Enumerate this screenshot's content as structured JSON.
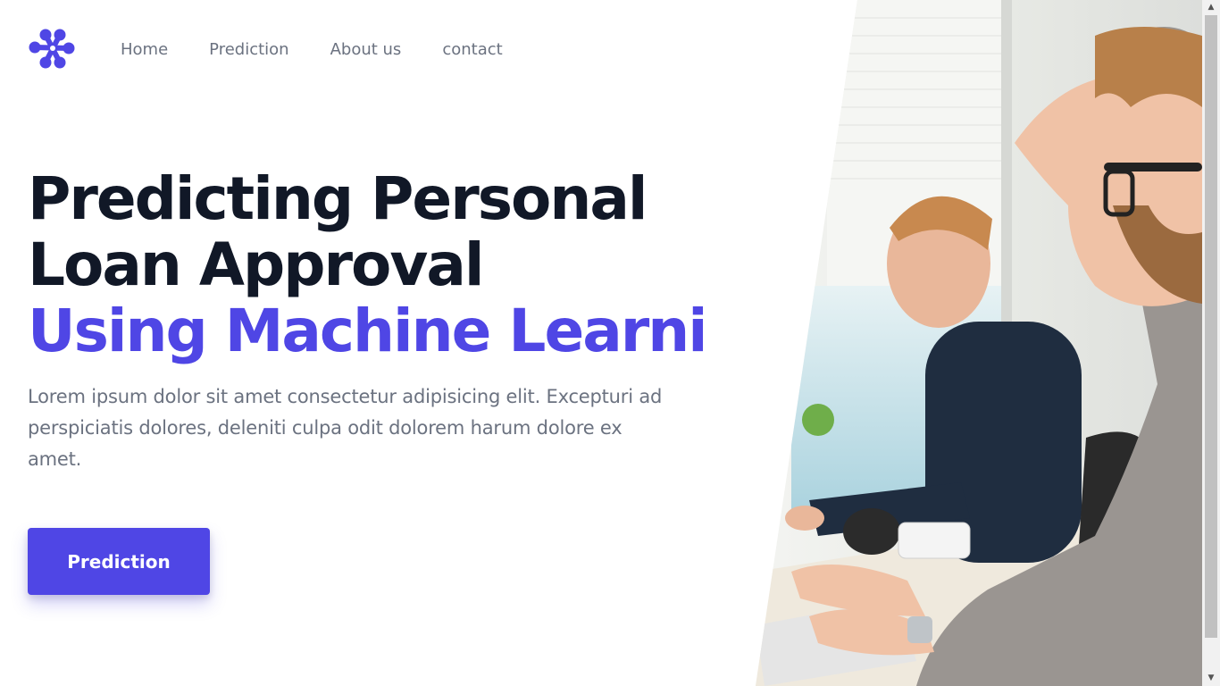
{
  "brand": {
    "logo_icon": "dots-arrow-logo-icon",
    "accent_color": "#4f46e5"
  },
  "nav": {
    "items": [
      {
        "label": "Home"
      },
      {
        "label": "Prediction"
      },
      {
        "label": "About us"
      },
      {
        "label": "contact"
      }
    ]
  },
  "hero": {
    "title_line1": "Predicting Personal",
    "title_line2": "Loan Approval",
    "title_line3": "Using Machine Learnig",
    "description": "Lorem ipsum dolor sit amet consectetur adipisicing elit. Excepturi ad perspiciatis dolores, deleniti culpa odit dolorem harum dolore ex amet.",
    "cta_label": "Prediction",
    "image_icon": "office-workers-photo"
  },
  "colors": {
    "heading": "#111827",
    "body_text": "#6b7280",
    "accent": "#4f46e5"
  }
}
